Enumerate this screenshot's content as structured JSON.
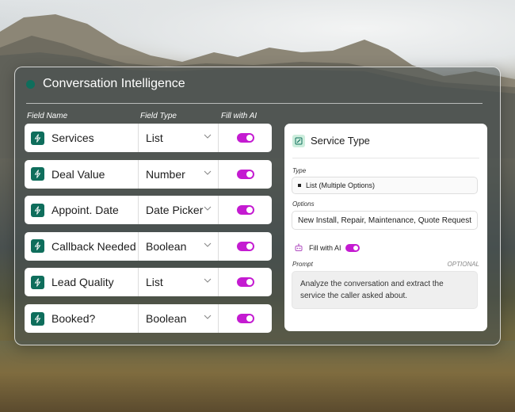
{
  "panel": {
    "title": "Conversation Intelligence",
    "columns": {
      "field_name": "Field Name",
      "field_type": "Field Type",
      "fill_ai": "Fill with AI"
    }
  },
  "fields": [
    {
      "name": "Services",
      "type": "List",
      "fill_with_ai": true
    },
    {
      "name": "Deal Value",
      "type": "Number",
      "fill_with_ai": true
    },
    {
      "name": "Appoint. Date",
      "type": "Date Picker",
      "fill_with_ai": true
    },
    {
      "name": "Callback Needed",
      "type": "Boolean",
      "fill_with_ai": true
    },
    {
      "name": "Lead Quality",
      "type": "List",
      "fill_with_ai": true
    },
    {
      "name": "Booked?",
      "type": "Boolean",
      "fill_with_ai": true
    }
  ],
  "detail": {
    "title": "Service Type",
    "type_label": "Type",
    "type_value": "List (Multiple Options)",
    "options_label": "Options",
    "options_value": "New Install, Repair, Maintenance, Quote Request",
    "fill_label": "Fill with AI",
    "fill_with_ai": true,
    "prompt_label": "Prompt",
    "prompt_optional": "OPTIONAL",
    "prompt_line1": "Analyze the conversation and extract the",
    "prompt_line2": "service the caller asked about."
  },
  "colors": {
    "accent": "#0f6e5c",
    "toggle_on": "#c41bd1"
  },
  "icons": {
    "field": "lightning-icon",
    "edit": "edit-icon",
    "chevron": "chevron-down-icon",
    "ai": "robot-icon"
  }
}
